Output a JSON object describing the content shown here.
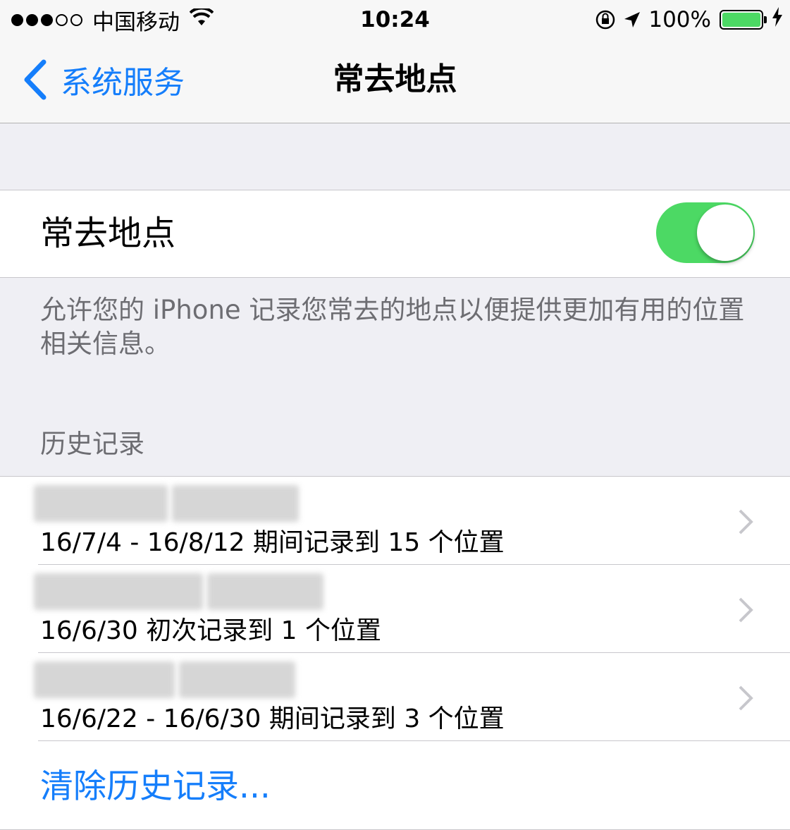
{
  "status_bar": {
    "carrier": "中国移动",
    "time": "10:24",
    "battery_percent": "100%",
    "battery_level": 1.0,
    "icons": [
      "signal-dots",
      "wifi-icon",
      "rotation-lock-icon",
      "location-arrow-icon",
      "battery-icon",
      "charging-bolt-icon"
    ]
  },
  "nav": {
    "back_label": "系统服务",
    "title": "常去地点"
  },
  "toggle": {
    "label": "常去地点",
    "on": true
  },
  "footer": "允许您的 iPhone 记录您常去的地点以便提供更加有用的位置相关信息。",
  "history": {
    "header": "历史记录",
    "items": [
      {
        "subtitle": "16/7/4 - 16/8/12 期间记录到 15 个位置"
      },
      {
        "subtitle": "16/6/30 初次记录到 1 个位置"
      },
      {
        "subtitle": "16/6/22 - 16/6/30 期间记录到 3 个位置"
      }
    ],
    "clear_label": "清除历史记录..."
  },
  "colors": {
    "accent": "#157efb",
    "switch_on": "#4cd964",
    "background": "#efeff4"
  }
}
